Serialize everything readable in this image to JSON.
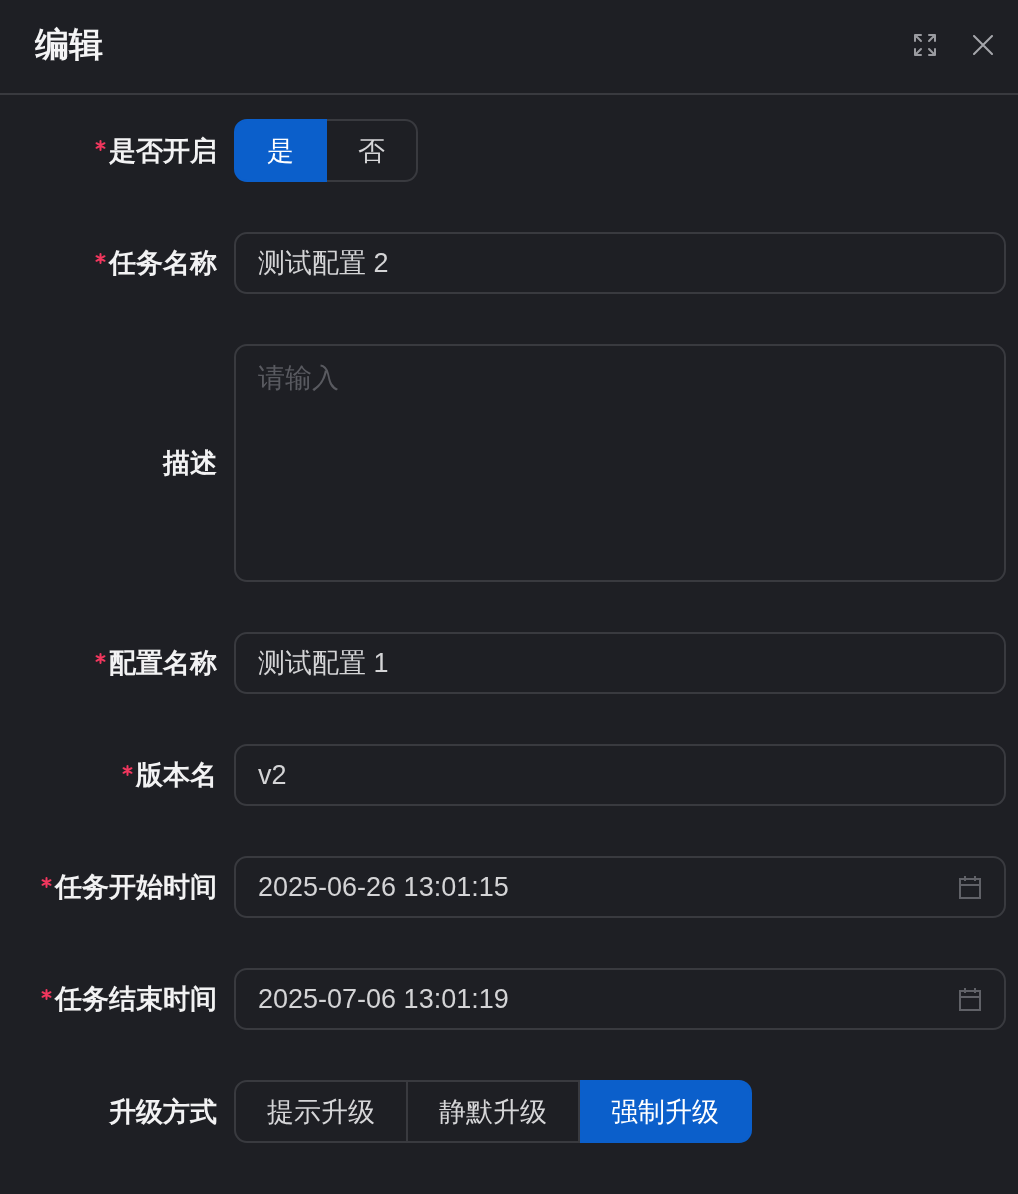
{
  "dialog": {
    "title": "编辑"
  },
  "form": {
    "fields": [
      {
        "kind": "segmented",
        "label": "是否开启",
        "required": true,
        "options": [
          {
            "label": "是",
            "selected": true
          },
          {
            "label": "否",
            "selected": false
          }
        ]
      },
      {
        "kind": "text",
        "label": "任务名称",
        "required": true,
        "value": "测试配置 2"
      },
      {
        "kind": "textarea",
        "label": "描述",
        "required": false,
        "placeholder": "请输入"
      },
      {
        "kind": "text",
        "label": "配置名称",
        "required": true,
        "value": "测试配置 1"
      },
      {
        "kind": "text",
        "label": "版本名",
        "required": true,
        "value": "v2"
      },
      {
        "kind": "datetime",
        "label": "任务开始时间",
        "required": true,
        "value": "2025-06-26 13:01:15"
      },
      {
        "kind": "datetime",
        "label": "任务结束时间",
        "required": true,
        "value": "2025-07-06 13:01:19"
      },
      {
        "kind": "segmented",
        "label": "升级方式",
        "required": false,
        "options": [
          {
            "label": "提示升级",
            "selected": false
          },
          {
            "label": "静默升级",
            "selected": false
          },
          {
            "label": "强制升级",
            "selected": true
          }
        ]
      }
    ]
  }
}
